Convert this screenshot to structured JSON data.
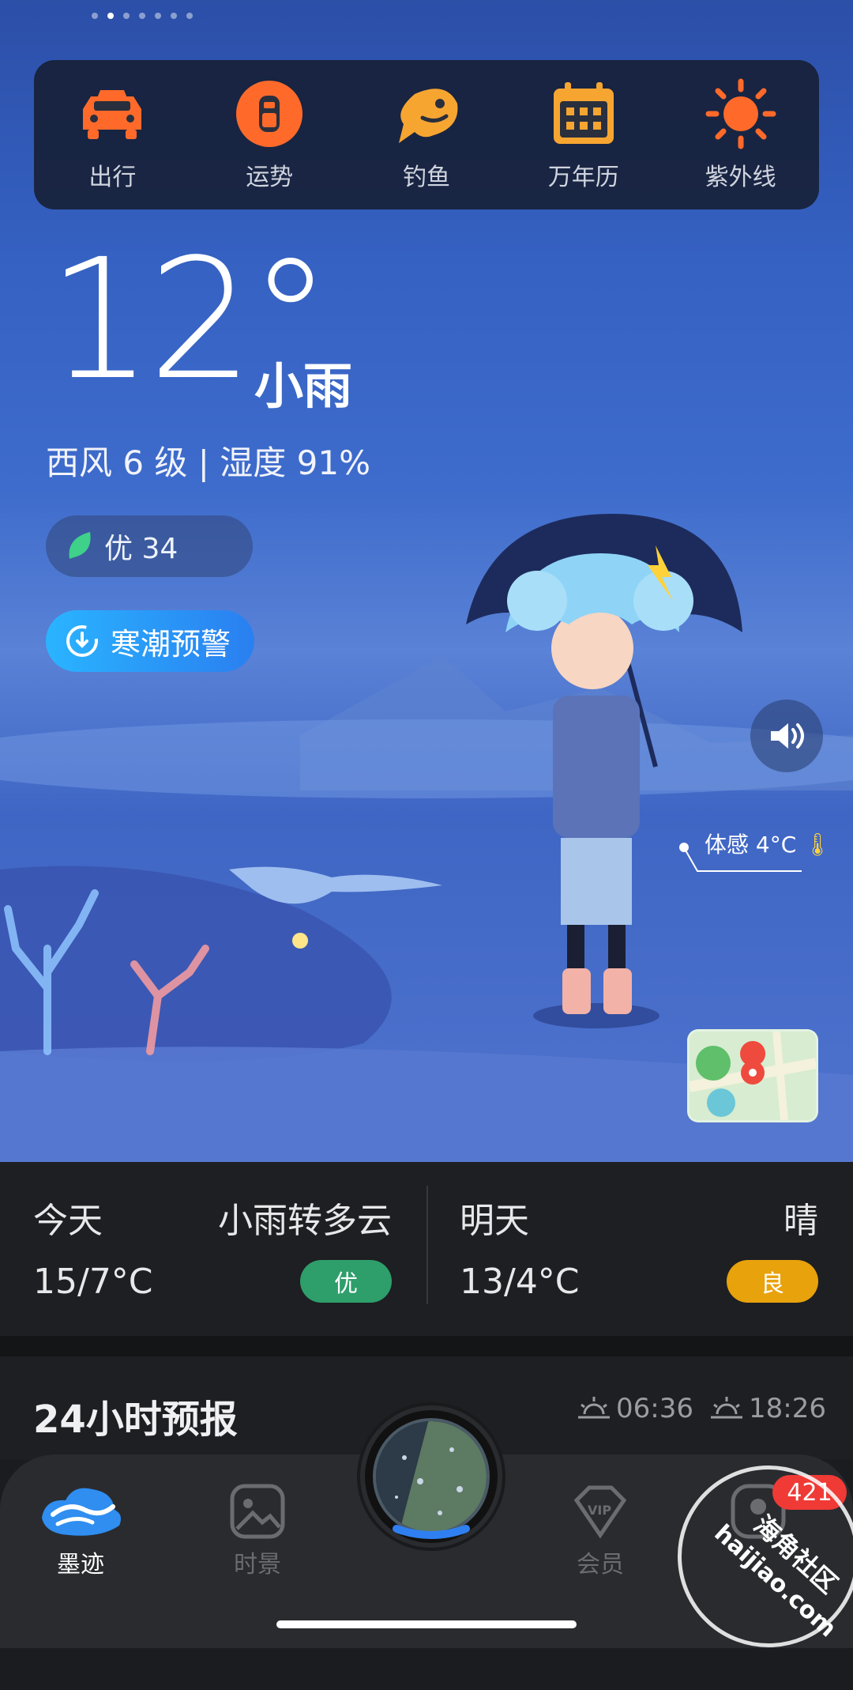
{
  "quick_actions": [
    {
      "label": "出行",
      "icon": "car-icon"
    },
    {
      "label": "运势",
      "icon": "fortune-icon"
    },
    {
      "label": "钓鱼",
      "icon": "fish-icon"
    },
    {
      "label": "万年历",
      "icon": "calendar-icon"
    },
    {
      "label": "紫外线",
      "icon": "sun-icon"
    }
  ],
  "current": {
    "temperature": "12°",
    "condition": "小雨",
    "wind_humidity": "西风 6 级 | 湿度 91%",
    "aqi": "优 34",
    "alert": "寒潮预警",
    "feels_like": "体感 4°C"
  },
  "forecast": {
    "today": {
      "day": "今天",
      "condition": "小雨转多云",
      "range": "15/7°C",
      "aqi": "优",
      "aqi_color": "#2e9e6b"
    },
    "tomorrow": {
      "day": "明天",
      "condition": "晴",
      "range": "13/4°C",
      "aqi": "良",
      "aqi_color": "#e8a20c"
    }
  },
  "hourly": {
    "title": "24小时预报",
    "sunrise": "06:36",
    "sunset": "18:26"
  },
  "tabs": [
    {
      "label": "墨迹",
      "icon": "moji-cloud-icon",
      "active": true
    },
    {
      "label": "时景",
      "icon": "photo-icon",
      "active": false
    },
    {
      "label": "会员",
      "icon": "vip-icon",
      "active": false
    },
    {
      "label": "",
      "icon": "profile-icon",
      "active": false
    }
  ],
  "notification_count": "421",
  "watermark": {
    "line1": "海角社区",
    "line2": "haijiao.com"
  }
}
